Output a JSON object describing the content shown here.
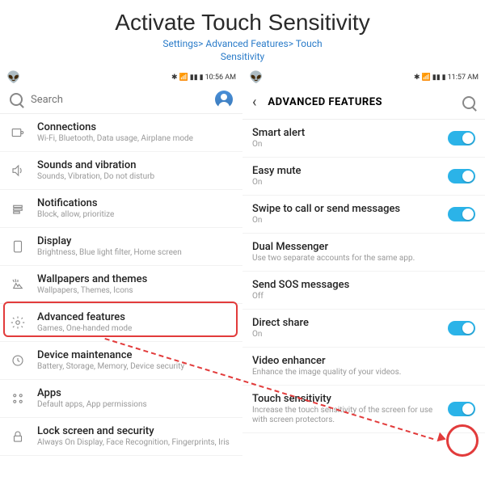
{
  "header": {
    "title": "Activate Touch Sensitivity",
    "breadcrumb_line1": "Settings> Advanced Features> Touch",
    "breadcrumb_line2": "Sensitivity"
  },
  "phone1": {
    "status_time": "10:56 AM",
    "search_placeholder": "Search",
    "items": [
      {
        "title": "Connections",
        "sub": "Wi-Fi, Bluetooth, Data usage, Airplane mode"
      },
      {
        "title": "Sounds and vibration",
        "sub": "Sounds, Vibration, Do not disturb"
      },
      {
        "title": "Notifications",
        "sub": "Block, allow, prioritize"
      },
      {
        "title": "Display",
        "sub": "Brightness, Blue light filter, Home screen"
      },
      {
        "title": "Wallpapers and themes",
        "sub": "Wallpapers, Themes, Icons"
      },
      {
        "title": "Advanced features",
        "sub": "Games, One-handed mode"
      },
      {
        "title": "Device maintenance",
        "sub": "Battery, Storage, Memory, Device security"
      },
      {
        "title": "Apps",
        "sub": "Default apps, App permissions"
      },
      {
        "title": "Lock screen and security",
        "sub": "Always On Display, Face Recognition, Fingerprints, Iris"
      }
    ]
  },
  "phone2": {
    "status_time": "11:57 AM",
    "header_title": "ADVANCED FEATURES",
    "items": [
      {
        "title": "Smart alert",
        "sub": "On",
        "toggle": true
      },
      {
        "title": "Easy mute",
        "sub": "On",
        "toggle": true
      },
      {
        "title": "Swipe to call or send messages",
        "sub": "On",
        "toggle": true
      },
      {
        "title": "Dual Messenger",
        "sub": "Use two separate accounts for the same app."
      },
      {
        "title": "Send SOS messages",
        "sub": "Off"
      },
      {
        "title": "Direct share",
        "sub": "On",
        "toggle": true
      },
      {
        "title": "Video enhancer",
        "sub": "Enhance the image quality of your videos."
      },
      {
        "title": "Touch sensitivity",
        "sub": "Increase the touch sensitivity of the screen for use with screen protectors.",
        "toggle": true
      }
    ]
  }
}
